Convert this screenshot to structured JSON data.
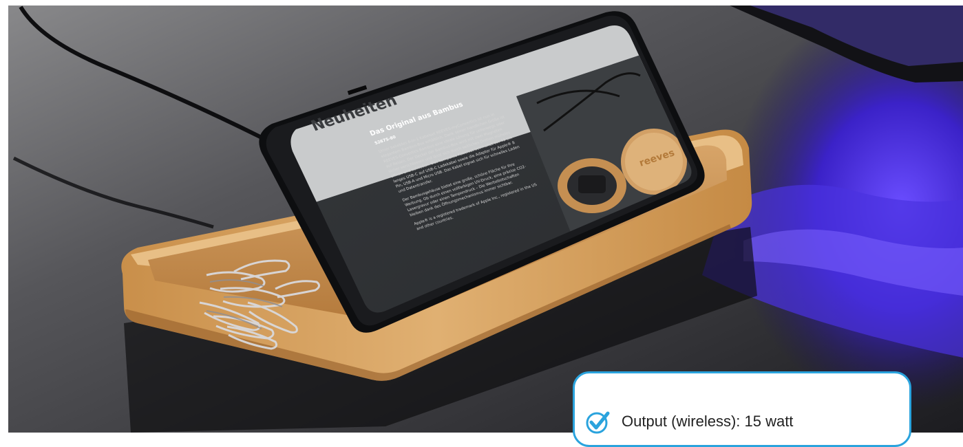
{
  "photo": {
    "description_free": true,
    "phone_screen": {
      "title": "Neuheiten",
      "subtitle": "Das Original aus Bambus",
      "article_no": "52675-80",
      "paragraph_1": "Unser beliebtes 6-in-1 Kabelset REEVES-myConvertics ist nun in elegantem Bambus-Box erhältlich. Dank seiner handlichen Größe ist REEVES-Convertics Bambus eine ideale Lösung für unterwegs oder auf Reisen. Der Deckel der Bambus-Box wird mit zwei Magneten sicher verschlossen und lässt sich durch seitliches Drehen mühelos öffnen und schließen. Das kompakte Kabelset beinhaltet ein 49 cm langes USB-C auf USB-C Ladekabel sowie die Adapter für Apple® 8 Pin, USB-A und Micro USB. Das Kabel eignet sich für schnelles Laden und Datentransfer.",
      "paragraph_2": "Der Bambusgehäuse bietet eine große, schöne Fläche für Ihre Werbung. Ob durch einen vollfarbigen UV-Druck, eine präzise CO2-Lasergravur oder einen Tampondruck – Die Werbebotschaften bleiben dank des Öffnungsmechanismus immer sichtbar.",
      "paragraph_3": "Apple® is a registered trademark of Apple Inc., registered in the US and other countries.",
      "product_logo": "reeves"
    }
  },
  "info_card": {
    "text": "Output (wireless): 15 watt",
    "icon": "check-circle-icon",
    "border_color": "#2aa3dd",
    "icon_color": "#2aa3dd"
  }
}
